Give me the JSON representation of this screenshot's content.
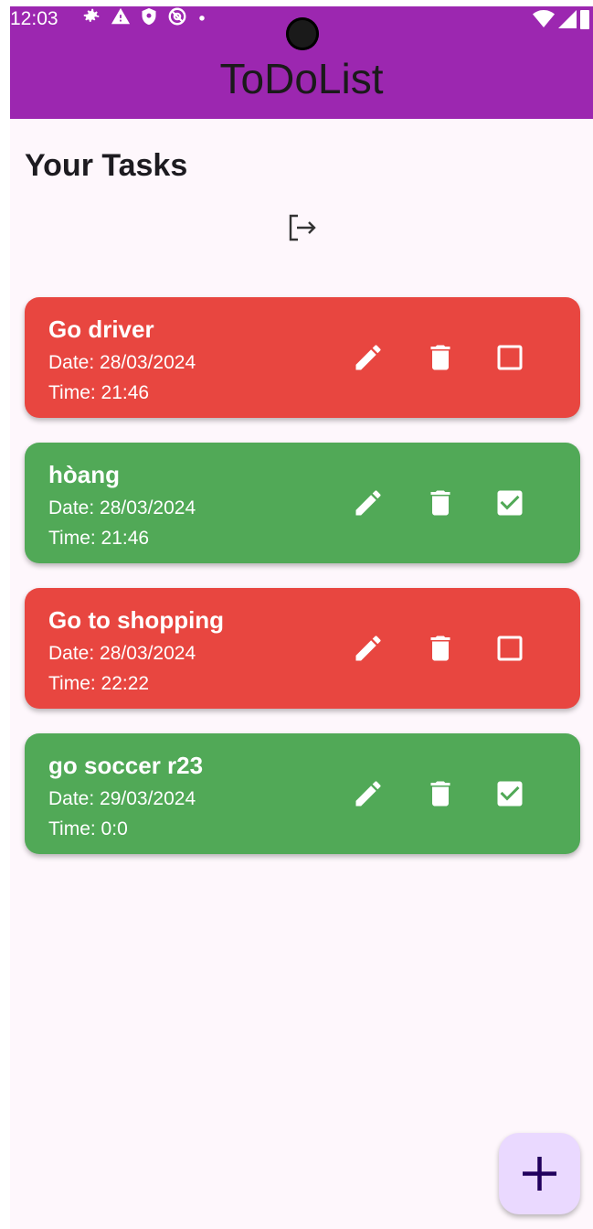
{
  "status_bar": {
    "time": "12:03",
    "icons": [
      "settings-icon",
      "warning-icon",
      "shield-icon",
      "at-circle-icon",
      "dot-icon"
    ],
    "right_icons": [
      "wifi-icon",
      "cell-signal-icon",
      "battery-icon"
    ]
  },
  "app_bar": {
    "title": "ToDoList",
    "color": "#9c27b0"
  },
  "page": {
    "heading": "Your Tasks",
    "logout_icon": "logout-icon"
  },
  "colors": {
    "pending": "#e84640",
    "done": "#51a957",
    "fab": "#ead9ff"
  },
  "tasks": [
    {
      "title": "Go driver",
      "date": "Date: 28/03/2024",
      "time": "Time: 21:46",
      "completed": false
    },
    {
      "title": "hòang",
      "date": "Date: 28/03/2024",
      "time": "Time: 21:46",
      "completed": true
    },
    {
      "title": "Go to shopping",
      "date": "Date: 28/03/2024",
      "time": "Time: 22:22",
      "completed": false
    },
    {
      "title": "go soccer r23",
      "date": "Date: 29/03/2024",
      "time": "Time: 0:0",
      "completed": true
    }
  ],
  "fab": {
    "icon": "plus-icon"
  }
}
